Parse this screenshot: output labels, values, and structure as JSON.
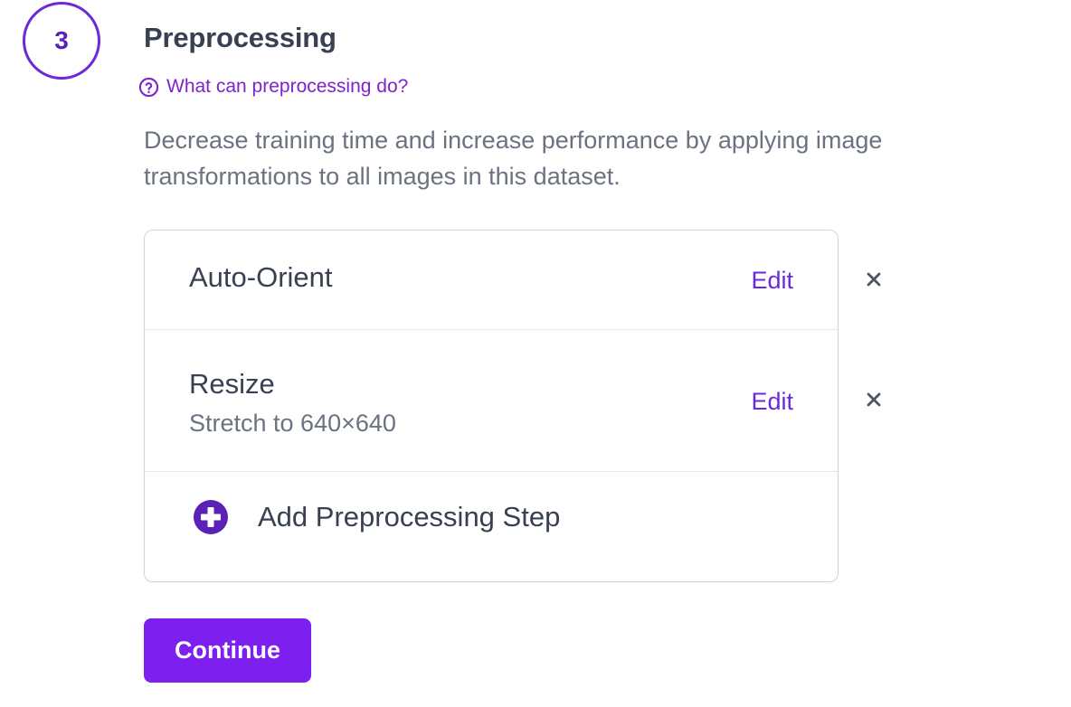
{
  "step": {
    "number": "3",
    "title": "Preprocessing"
  },
  "help": {
    "icon": "question-circle-icon",
    "label": "What can preprocessing do?"
  },
  "description": "Decrease training time and increase performance by applying image transformations to all images in this dataset.",
  "preprocessing_steps": [
    {
      "name": "Auto-Orient",
      "detail": "",
      "edit_label": "Edit",
      "remove_icon": "close-icon"
    },
    {
      "name": "Resize",
      "detail": "Stretch to 640×640",
      "edit_label": "Edit",
      "remove_icon": "close-icon"
    }
  ],
  "add_step": {
    "icon": "plus-circle-icon",
    "label": "Add Preprocessing Step"
  },
  "continue_label": "Continue",
  "colors": {
    "accent": "#6d28d9",
    "button": "#7c1fef",
    "text": "#374151",
    "muted": "#6b7280"
  }
}
